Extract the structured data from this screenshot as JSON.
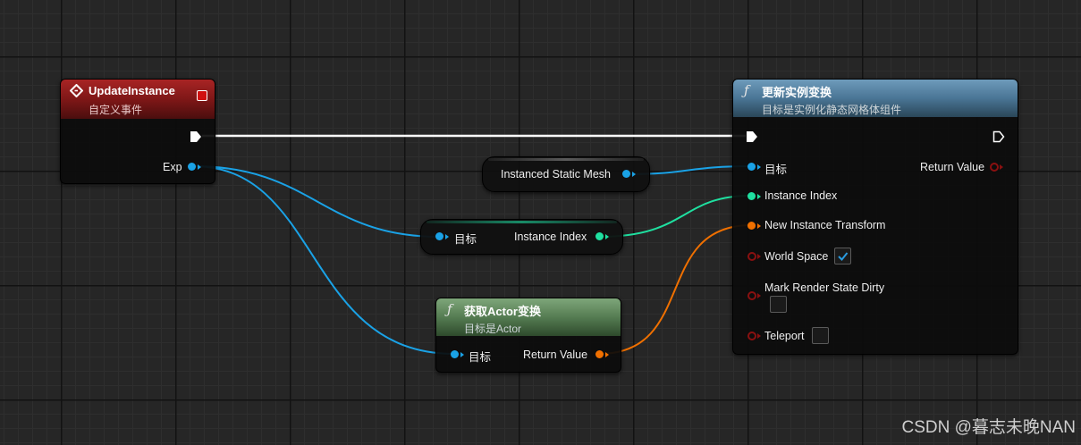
{
  "colors": {
    "object_pin": "#1aa2e6",
    "int_pin": "#1fe0a0",
    "transform_pin": "#f07000",
    "bool_pin": "#8a1010",
    "exec_wire": "#ffffff"
  },
  "event_node": {
    "title": "UpdateInstance",
    "subtitle": "自定义事件",
    "output_pin": "Exp",
    "icon": "event-diamond-icon"
  },
  "function_node": {
    "title": "更新实例变换",
    "subtitle": "目标是实例化静态网格体组件",
    "icon": "function-f-icon",
    "inputs": {
      "target": "目标",
      "instance_index": "Instance Index",
      "new_transform": "New Instance Transform",
      "world_space": "World Space",
      "mark_dirty": "Mark Render State Dirty",
      "teleport": "Teleport"
    },
    "output": "Return Value",
    "world_space_checked": true,
    "mark_dirty_checked": false,
    "teleport_checked": false
  },
  "var_mesh": {
    "label": "Instanced Static Mesh"
  },
  "var_index": {
    "input": "目标",
    "output": "Instance Index"
  },
  "get_transform_node": {
    "title": "获取Actor变换",
    "subtitle": "目标是Actor",
    "input": "目标",
    "output": "Return Value",
    "icon": "function-f-icon"
  },
  "watermark": "CSDN @暮志未晚NAN"
}
